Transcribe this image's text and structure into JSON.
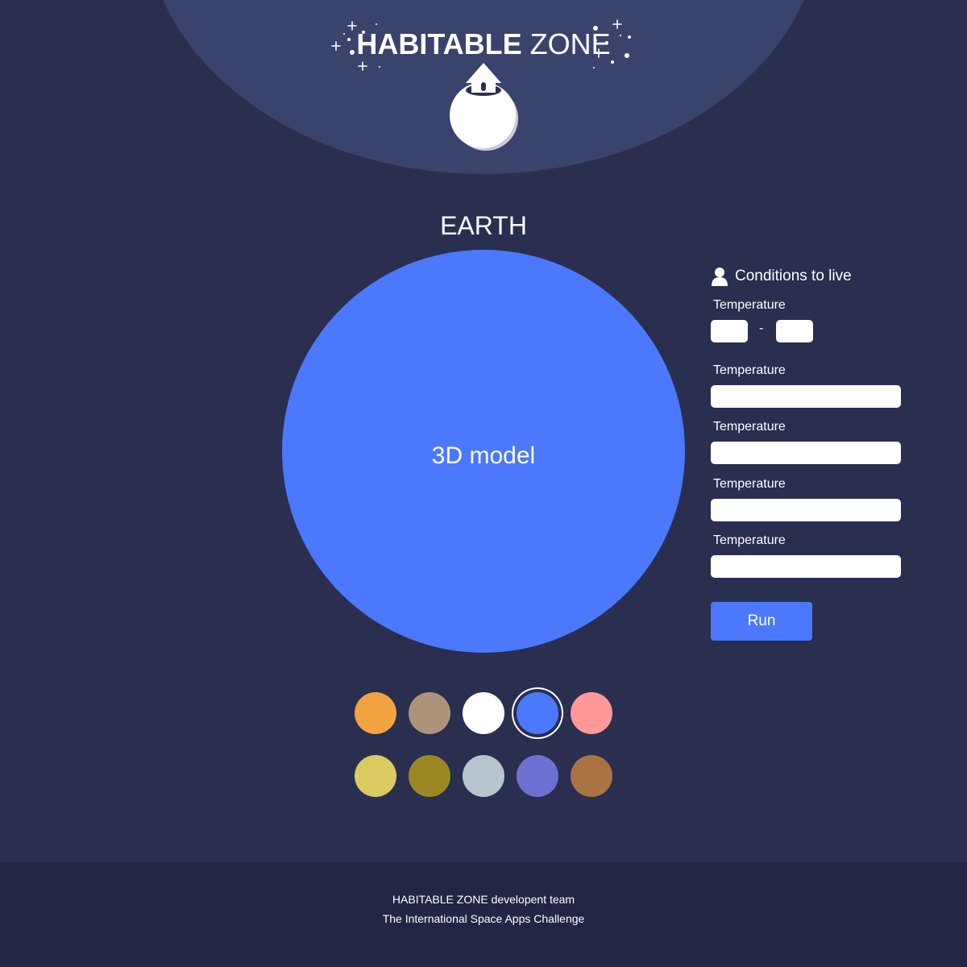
{
  "header": {
    "logo_bold": "HABITABLE",
    "logo_light": "ZONE",
    "logo_icon": "planet-house-icon"
  },
  "planet": {
    "name": "EARTH",
    "model_label": "3D model",
    "color": "#4b78fc"
  },
  "conditions": {
    "title": "Conditions to live",
    "icon": "person-icon",
    "range": {
      "label": "Temperature",
      "separator": "-",
      "min_value": "",
      "max_value": ""
    },
    "fields": [
      {
        "label": "Temperature",
        "value": ""
      },
      {
        "label": "Temperature",
        "value": ""
      },
      {
        "label": "Temperature",
        "value": ""
      },
      {
        "label": "Temperature",
        "value": ""
      }
    ],
    "run_label": "Run"
  },
  "colors": {
    "accent": "#4b78fc",
    "background": "#2a2f50",
    "dome": "#3a436c",
    "footer": "#222544"
  },
  "swatches": [
    {
      "color": "#f0a33f",
      "selected": false
    },
    {
      "color": "#ae937b",
      "selected": false
    },
    {
      "color": "#ffffff",
      "selected": false
    },
    {
      "color": "#4b78fc",
      "selected": true
    },
    {
      "color": "#ff9898",
      "selected": false
    },
    {
      "color": "#dbc962",
      "selected": false
    },
    {
      "color": "#9c8822",
      "selected": false
    },
    {
      "color": "#b8c4cb",
      "selected": false
    },
    {
      "color": "#6e70d1",
      "selected": false
    },
    {
      "color": "#a97442",
      "selected": false
    }
  ],
  "footer": {
    "team_bold": "HABITABLE",
    "team_rest": "ZONE developent team",
    "challenge": "The International Space Apps Challenge"
  }
}
